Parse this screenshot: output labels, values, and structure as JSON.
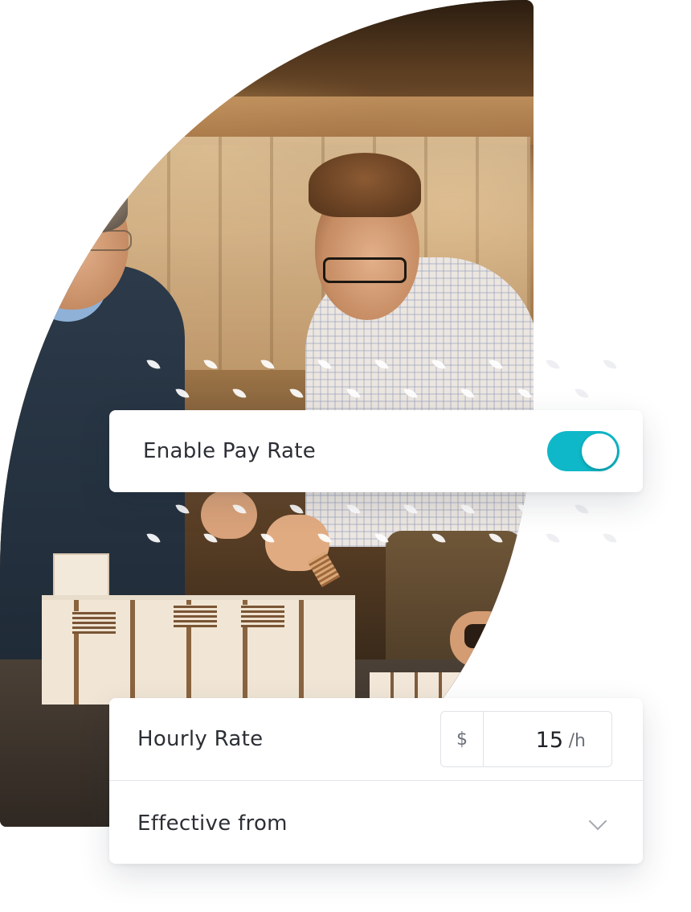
{
  "pay_rate_toggle": {
    "label": "Enable Pay Rate",
    "enabled": true,
    "accent_color": "#0eb8c8"
  },
  "rate_form": {
    "hourly_rate": {
      "label": "Hourly Rate",
      "currency_symbol": "$",
      "value": "15",
      "unit": "/h"
    },
    "effective_from": {
      "label": "Effective from",
      "icon": "chevron-down-icon"
    }
  },
  "photo": {
    "icon": "architecture-team-photo"
  }
}
